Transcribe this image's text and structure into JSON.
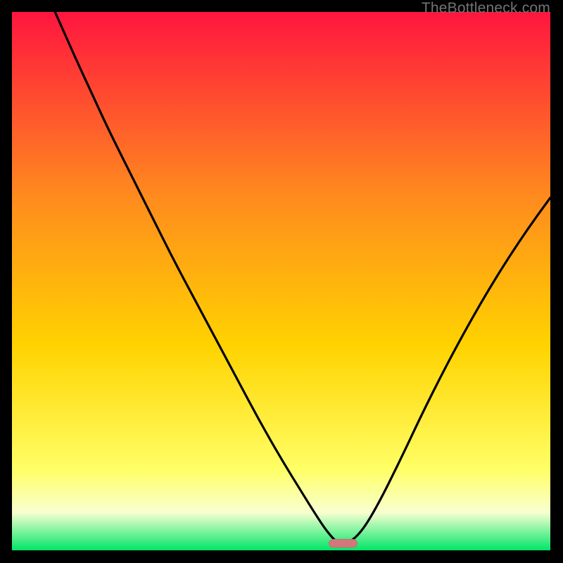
{
  "watermark": {
    "text": "TheBottleneck.com"
  },
  "colors": {
    "gradient_top": "#ff153f",
    "gradient_mid1": "#ff6a26",
    "gradient_mid2": "#ffd300",
    "gradient_mid3": "#ffff66",
    "gradient_low": "#f8ffd0",
    "gradient_bottom": "#00e668",
    "curve": "#000000",
    "marker_fill": "#d2787c",
    "marker_stroke": "#c96a6f"
  },
  "chart_data": {
    "type": "line",
    "title": "",
    "xlabel": "",
    "ylabel": "",
    "xlim": [
      0,
      100
    ],
    "ylim": [
      0,
      100
    ],
    "series": [
      {
        "name": "bottleneck-curve",
        "x": [
          8.0,
          10,
          12,
          15,
          18,
          22,
          26,
          30,
          34,
          38,
          42,
          46,
          50,
          54,
          56.5,
          58.5,
          60.5,
          62.5,
          65,
          68,
          72,
          76,
          80,
          84,
          88,
          92,
          96,
          100
        ],
        "y": [
          100,
          95.5,
          91,
          84.5,
          78,
          70,
          62,
          54,
          46.5,
          39,
          31.5,
          24,
          17,
          10.5,
          6.5,
          3.5,
          1.3,
          1.3,
          3.5,
          8.5,
          16.5,
          25,
          33,
          40.5,
          47.5,
          54,
          60,
          65.5
        ]
      }
    ],
    "marker": {
      "name": "optimal-point",
      "x_center": 61.5,
      "y_center": 1.3,
      "width": 5.2,
      "height": 1.5
    }
  }
}
